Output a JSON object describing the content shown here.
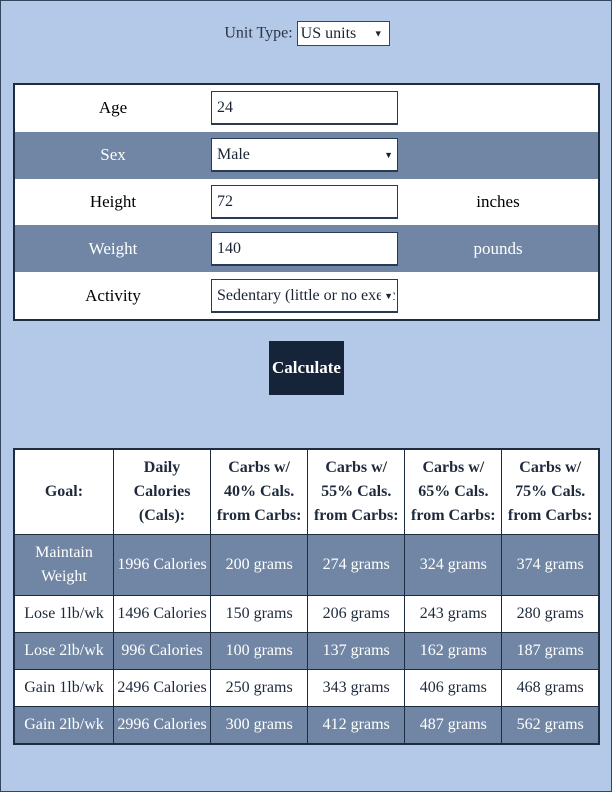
{
  "unit_type": {
    "label": "Unit Type:",
    "value": "US units"
  },
  "form": {
    "age": {
      "label": "Age",
      "value": "24"
    },
    "sex": {
      "label": "Sex",
      "value": "Male"
    },
    "height": {
      "label": "Height",
      "value": "72",
      "unit": "inches"
    },
    "weight": {
      "label": "Weight",
      "value": "140",
      "unit": "pounds"
    },
    "activity": {
      "label": "Activity",
      "value": "Sedentary (little or no exerc"
    }
  },
  "calculate_label": "Calculate",
  "results": {
    "headers": [
      "Goal:",
      "Daily Calories (Cals):",
      "Carbs w/ 40% Cals. from Carbs:",
      "Carbs w/ 55% Cals. from Carbs:",
      "Carbs w/ 65% Cals. from Carbs:",
      "Carbs w/ 75% Cals. from Carbs:"
    ],
    "rows": [
      [
        "Maintain Weight",
        "1996 Calories",
        "200 grams",
        "274 grams",
        "324 grams",
        "374 grams"
      ],
      [
        "Lose 1lb/wk",
        "1496 Calories",
        "150 grams",
        "206 grams",
        "243 grams",
        "280 grams"
      ],
      [
        "Lose 2lb/wk",
        "996 Calories",
        "100 grams",
        "137 grams",
        "162 grams",
        "187 grams"
      ],
      [
        "Gain 1lb/wk",
        "2496 Calories",
        "250 grams",
        "343 grams",
        "406 grams",
        "468 grams"
      ],
      [
        "Gain 2lb/wk",
        "2996 Calories",
        "300 grams",
        "412 grams",
        "487 grams",
        "562 grams"
      ]
    ]
  },
  "colors": {
    "background": "#b4c9e8",
    "row_dark": "#7086a4",
    "button": "#16243a"
  }
}
